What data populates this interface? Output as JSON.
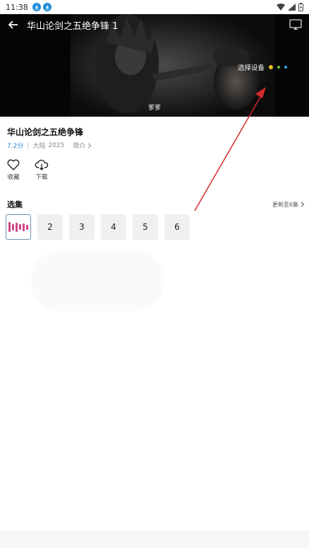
{
  "status_bar": {
    "time": "11:38",
    "notification_icons": [
      "download-icon",
      "download-icon"
    ],
    "right_icons": [
      "wifi-icon",
      "signal-icon",
      "battery-icon"
    ]
  },
  "player": {
    "title": "华山论剑之五绝争锋 1",
    "device_label": "选择设备",
    "subtitle": "爹爹",
    "device_dot_colors": [
      "#f0c020",
      "#6abf3a",
      "#2aa7e0"
    ]
  },
  "show": {
    "title": "华山论剑之五绝争锋",
    "rating": "7.2分",
    "region": "大陆",
    "year": "2025",
    "intro_label": "简介"
  },
  "actions": [
    {
      "label": "收藏",
      "icon": "heart-icon"
    },
    {
      "label": "下载",
      "icon": "cloud-download-icon"
    }
  ],
  "episodes": {
    "title": "选集",
    "update_info": "更新至6集",
    "items": [
      "",
      "2",
      "3",
      "4",
      "5",
      "6"
    ],
    "active_index": 0
  },
  "colors": {
    "accent_rating": "#2a86d8",
    "playing_bars": "#d6448a",
    "annotation_arrow": "#d42a2a"
  }
}
